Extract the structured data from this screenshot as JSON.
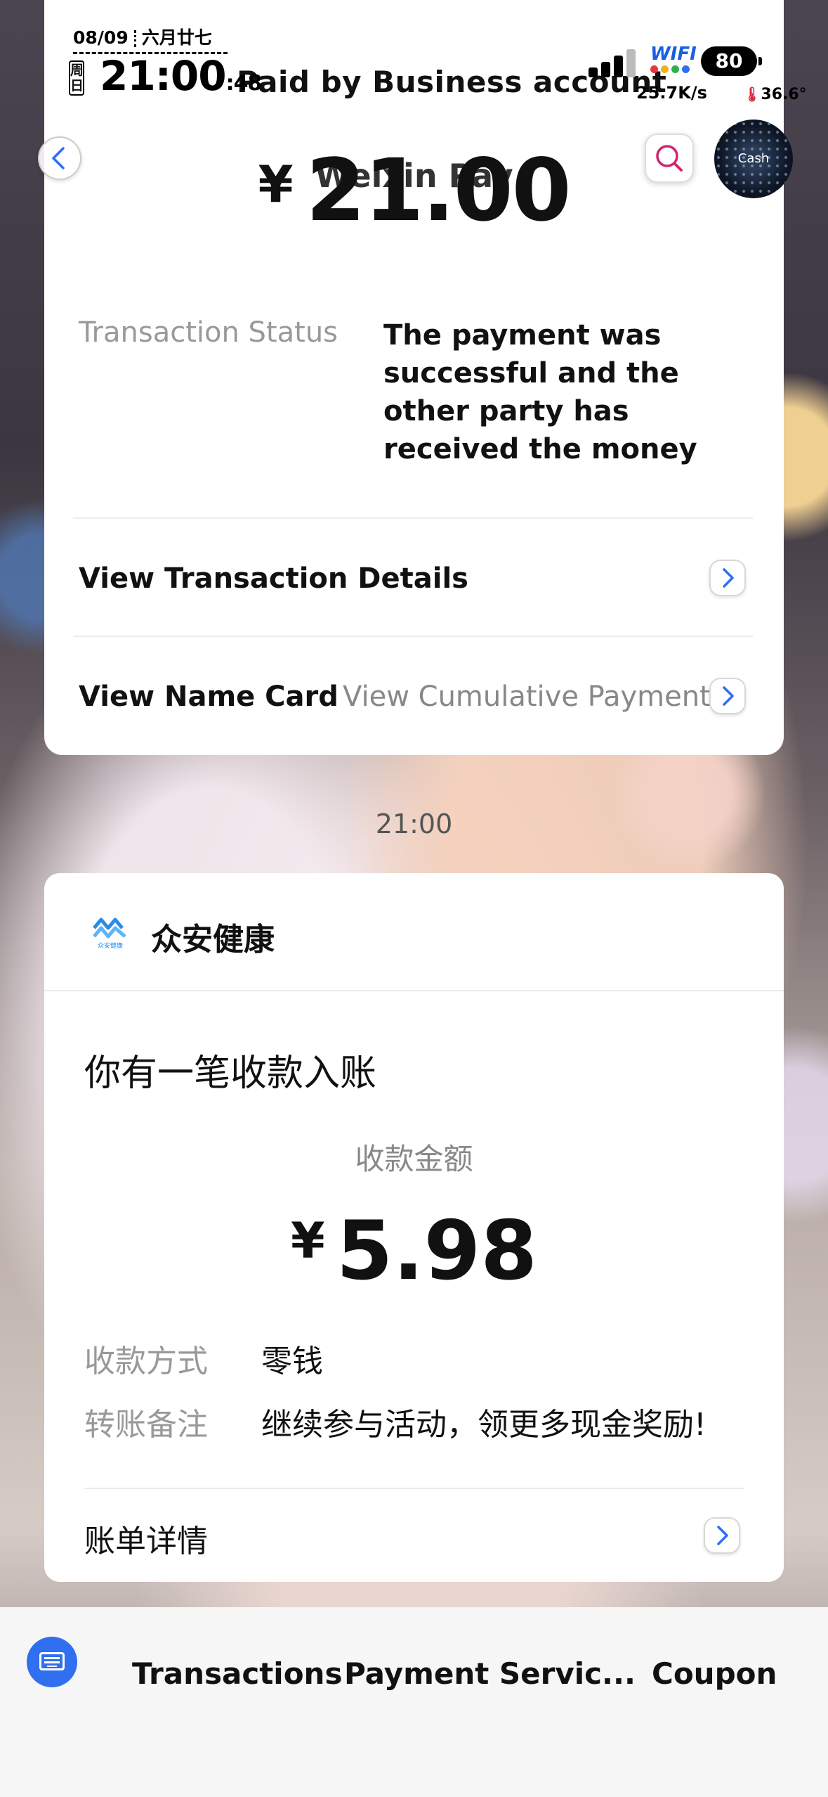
{
  "status_bar": {
    "date": "08/09",
    "lunar_date": "六月廿七",
    "weekday": "周日",
    "time": "21:00",
    "seconds": ":48",
    "wifi_label": "WIFI",
    "net_speed": "25.7K/s",
    "battery": "80",
    "temperature": "36.6°"
  },
  "header": {
    "title": "Weixin Pay",
    "paid_by": "Paid by Business account",
    "currency": "¥",
    "amount": "21.00",
    "cash_label": "Cash"
  },
  "details": {
    "status_label": "Transaction Status",
    "status_value": "The payment was successful and the other party has received the money",
    "view_details": "View Transaction Details",
    "view_name_card": "View Name Card",
    "view_cumulative": "View Cumulative Payment"
  },
  "message_time": "21:00",
  "notification": {
    "brand": "众安健康",
    "brand_logo_text": "众安健康",
    "title": "你有一笔收款入账",
    "amount_label": "收款金额",
    "currency": "¥",
    "amount": "5.98",
    "method_label": "收款方式",
    "method_value": "零钱",
    "remark_label": "转账备注",
    "remark_value": "继续参与活动，领更多现金奖励!",
    "bill_details": "账单详情"
  },
  "bottom_bar": {
    "tabs": [
      "Transactions",
      "Payment Servic...",
      "Coupon"
    ]
  },
  "colors": {
    "accent_blue": "#2f6ff0",
    "brand_blue": "#2a8be8",
    "search_pink": "#d0256e"
  }
}
